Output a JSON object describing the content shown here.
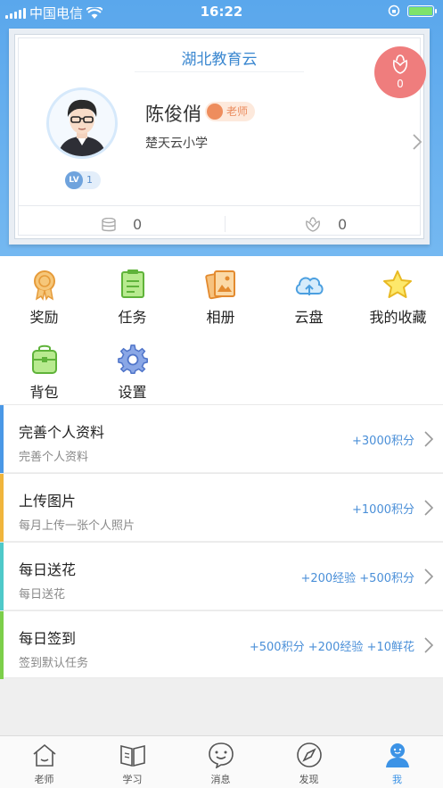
{
  "status_bar": {
    "carrier": "中国电信",
    "time": "16:22"
  },
  "profile": {
    "app_title": "湖北教育云",
    "flower_count": "0",
    "name": "陈俊俏",
    "role": "老师",
    "school": "楚天云小学",
    "level_tag": "LV",
    "level": "1",
    "coins": "0",
    "flowers": "0"
  },
  "menu": [
    {
      "label": "奖励",
      "icon": "award-icon"
    },
    {
      "label": "任务",
      "icon": "task-icon"
    },
    {
      "label": "相册",
      "icon": "album-icon"
    },
    {
      "label": "云盘",
      "icon": "cloud-drive-icon"
    },
    {
      "label": "我的收藏",
      "icon": "star-icon"
    },
    {
      "label": "背包",
      "icon": "backpack-icon"
    },
    {
      "label": "设置",
      "icon": "gear-icon"
    }
  ],
  "tasks": [
    {
      "title": "完善个人资料",
      "subtitle": "完善个人资料",
      "points": "+3000积分",
      "color": "#4a98e6"
    },
    {
      "title": "上传图片",
      "subtitle": "每月上传一张个人照片",
      "points": "+1000积分",
      "color": "#f0b53c"
    },
    {
      "title": "每日送花",
      "subtitle": "每日送花",
      "points": "+200经验 +500积分",
      "color": "#4fc9c9"
    },
    {
      "title": "每日签到",
      "subtitle": "签到默认任务",
      "points": "+500积分 +200经验 +10鲜花",
      "color": "#7ccf4a"
    }
  ],
  "tabs": [
    {
      "label": "老师",
      "icon": "teacher-home-icon"
    },
    {
      "label": "学习",
      "icon": "book-icon"
    },
    {
      "label": "消息",
      "icon": "message-icon"
    },
    {
      "label": "发现",
      "icon": "compass-icon"
    },
    {
      "label": "我",
      "icon": "profile-icon",
      "active": true
    }
  ]
}
